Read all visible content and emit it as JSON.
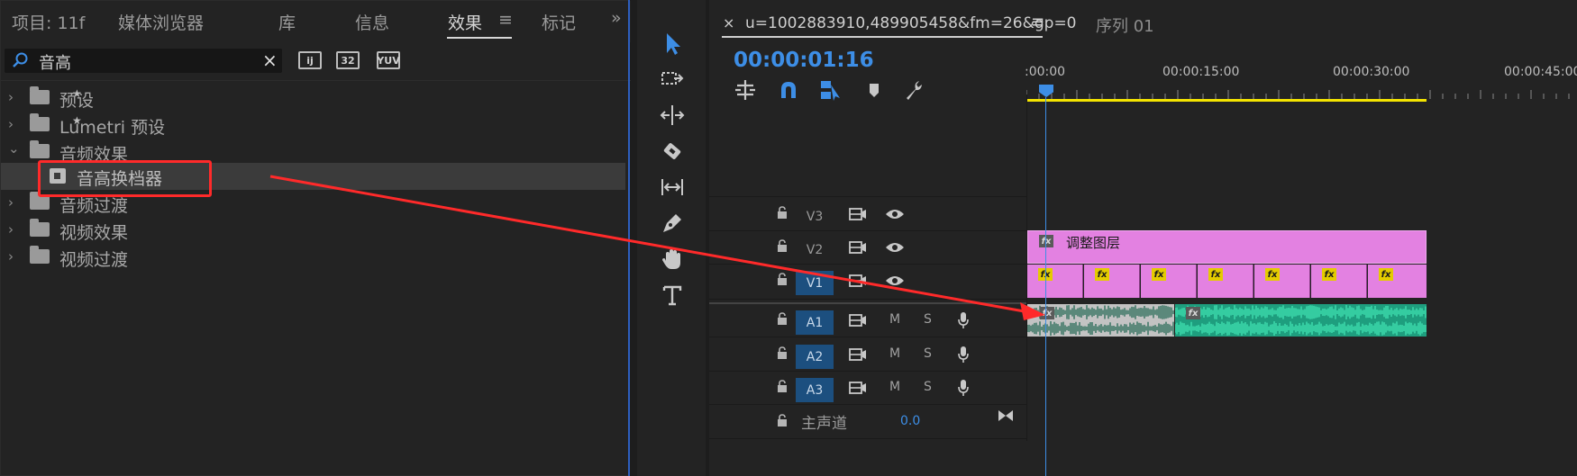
{
  "left_panel": {
    "tabs": [
      {
        "label": "项目: 11f"
      },
      {
        "label": "媒体浏览器"
      },
      {
        "label": "库"
      },
      {
        "label": "信息"
      },
      {
        "label": "效果"
      },
      {
        "label": "标记"
      }
    ],
    "active_tab_menu": "≡",
    "overflow": "»",
    "search": {
      "value": "音高",
      "clear_icon": "×"
    },
    "toolbar_badges": [
      "ĳ",
      "32",
      "YUV"
    ],
    "tree": [
      {
        "label": "预设",
        "chevron": "›"
      },
      {
        "label": "Lumetri 预设",
        "chevron": "›"
      },
      {
        "label": "音频效果",
        "chevron": "⌄"
      },
      {
        "label": "音高换档器"
      },
      {
        "label": "音频过渡",
        "chevron": "›"
      },
      {
        "label": "视频效果",
        "chevron": "›"
      },
      {
        "label": "视频过渡",
        "chevron": "›"
      }
    ]
  },
  "timeline": {
    "tab_close": "×",
    "tab_title": "u=1002883910,489905458&fm=26&gp=0",
    "tab_menu": "≡",
    "sequence_tab": "序列 01",
    "timecode": "00:00:01:16",
    "ruler_labels": [
      ":00:00",
      "00:00:15:00",
      "00:00:30:00",
      "00:00:45:00"
    ],
    "tracks": {
      "video": [
        {
          "label": "V3",
          "targeted": false
        },
        {
          "label": "V2",
          "targeted": false
        },
        {
          "label": "V1",
          "targeted": true
        }
      ],
      "audio": [
        {
          "label": "A1",
          "targeted": true,
          "mute": "M",
          "solo": "S"
        },
        {
          "label": "A2",
          "targeted": true,
          "mute": "M",
          "solo": "S"
        },
        {
          "label": "A3",
          "targeted": true,
          "mute": "M",
          "solo": "S"
        }
      ],
      "master": {
        "label": "主声道",
        "value": "0.0"
      }
    },
    "clips": {
      "adjustment_layer": "调整图层",
      "fx": "fx"
    }
  },
  "colors": {
    "accent_blue": "#3d8ee6",
    "clip_pink": "#e381e1",
    "audio_green": "#1e9e7e",
    "highlight_red": "#ff2a2a",
    "ruler_yellow": "#f4e400"
  }
}
